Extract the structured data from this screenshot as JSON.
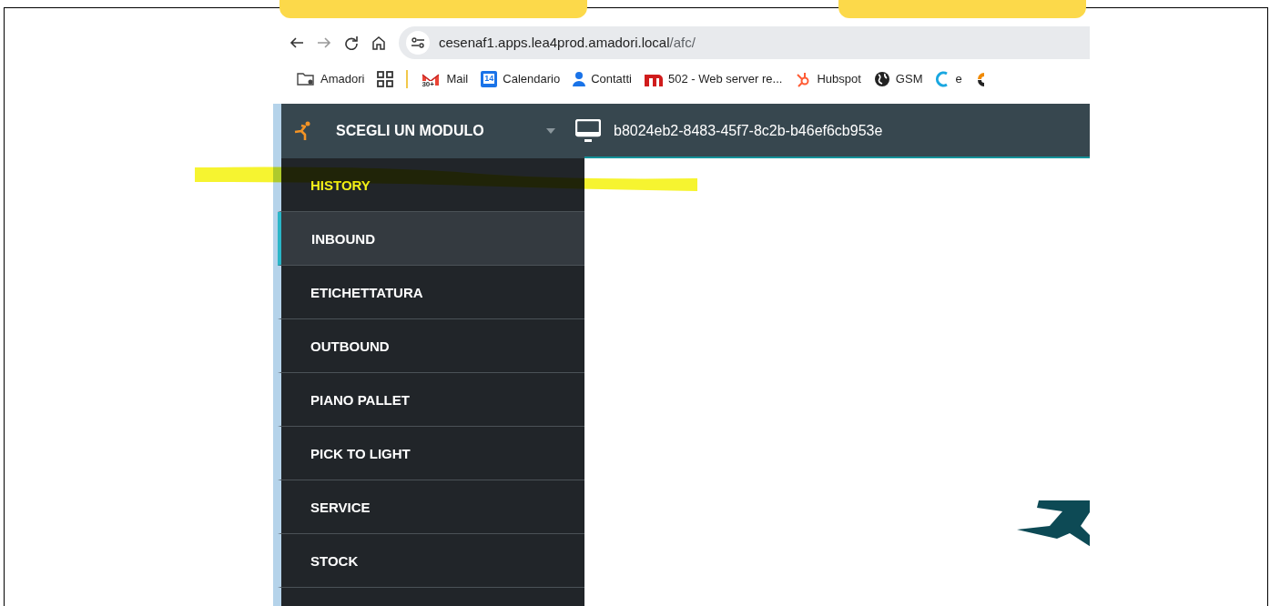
{
  "browser": {
    "url_host": "cesenaf1.apps.lea4prod.amadori.local",
    "url_path": "/afc/"
  },
  "bookmarks": [
    {
      "kind": "folder",
      "label": "Amadori"
    },
    {
      "kind": "apps"
    },
    {
      "kind": "separator"
    },
    {
      "kind": "mail",
      "label": "Mail",
      "badge": "30+"
    },
    {
      "kind": "calendar",
      "label": "Calendario",
      "badge": "14"
    },
    {
      "kind": "person",
      "label": "Contatti"
    },
    {
      "kind": "m",
      "label": "502 - Web server re..."
    },
    {
      "kind": "hub",
      "label": "Hubspot"
    },
    {
      "kind": "globe",
      "label": "GSM"
    },
    {
      "kind": "c",
      "label": "e"
    },
    {
      "kind": "partial"
    }
  ],
  "header": {
    "module_picker": "SCEGLI UN MODULO",
    "device_id": "b8024eb2-8483-45f7-8c2b-b46ef6cb953e"
  },
  "sidebar": {
    "items": [
      {
        "label": "HISTORY",
        "selected": false,
        "highlighted": true
      },
      {
        "label": "INBOUND",
        "selected": true,
        "highlighted": false
      },
      {
        "label": "ETICHETTATURA",
        "selected": false,
        "highlighted": false
      },
      {
        "label": "OUTBOUND",
        "selected": false,
        "highlighted": false
      },
      {
        "label": "PIANO PALLET",
        "selected": false,
        "highlighted": false
      },
      {
        "label": "PICK TO LIGHT",
        "selected": false,
        "highlighted": false
      },
      {
        "label": "SERVICE",
        "selected": false,
        "highlighted": false
      },
      {
        "label": "STOCK",
        "selected": false,
        "highlighted": false
      }
    ]
  }
}
